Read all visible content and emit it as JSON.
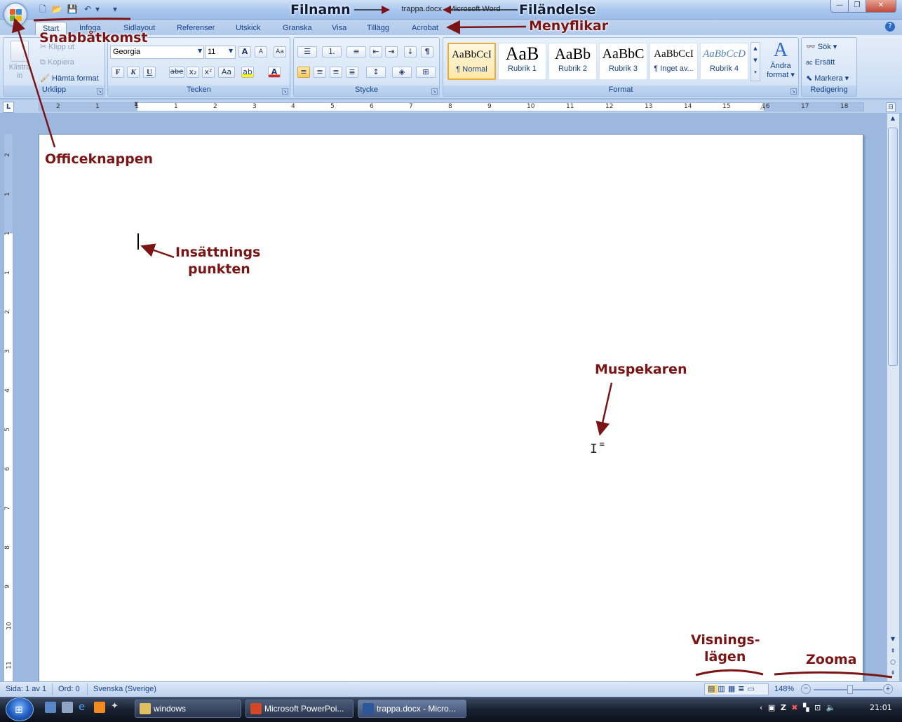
{
  "window": {
    "title_file": "trappa.docx",
    "title_sep": " - ",
    "title_app": "Microsoft Word",
    "minimize": "—",
    "maximize": "❐",
    "close": "✕"
  },
  "tabs": [
    "Start",
    "Infoga",
    "Sidlayout",
    "Referenser",
    "Utskick",
    "Granska",
    "Visa",
    "Tillägg",
    "Acrobat"
  ],
  "ribbon": {
    "clipboard": {
      "label": "Urklipp",
      "paste": "Klistra",
      "paste2": "in",
      "cut": "Klipp ut",
      "copy": "Kopiera",
      "format_painter": "Hämta format"
    },
    "font": {
      "label": "Tecken",
      "font_name": "Georgia",
      "font_size": "11",
      "bold": "F",
      "italic": "K",
      "underline": "U",
      "strike": "abe",
      "subscript": "x₂",
      "superscript": "x²",
      "case": "Aa",
      "grow": "A",
      "shrink": "A",
      "color": "A"
    },
    "paragraph": {
      "label": "Stycke"
    },
    "styles": {
      "label": "Format",
      "tiles": [
        {
          "preview": "AaBbCcI",
          "name": "¶ Normal"
        },
        {
          "preview": "AaB",
          "name": "Rubrik 1"
        },
        {
          "preview": "AaBb",
          "name": "Rubrik 2"
        },
        {
          "preview": "AaBbC",
          "name": "Rubrik 3"
        },
        {
          "preview": "AaBbCcI",
          "name": "¶ Inget av..."
        },
        {
          "preview": "AaBbCcD",
          "name": "Rubrik 4"
        }
      ],
      "change": "Ändra",
      "change2": "format"
    },
    "editing": {
      "label": "Redigering",
      "find": "Sök",
      "replace": "Ersätt",
      "select": "Markera"
    }
  },
  "ruler": {
    "h_numbers": [
      "2",
      "1",
      "1",
      "1",
      "2",
      "3",
      "4",
      "5",
      "6",
      "7",
      "8",
      "9",
      "10",
      "11",
      "12",
      "13",
      "14",
      "15",
      "16",
      "17",
      "18"
    ],
    "v_numbers": [
      "2",
      "1",
      "1",
      "1",
      "2",
      "3",
      "4",
      "5",
      "6",
      "7",
      "8",
      "9",
      "10",
      "11"
    ]
  },
  "statusbar": {
    "page": "Sida: 1 av 1",
    "words": "Ord: 0",
    "language": "Svenska (Sverige)",
    "zoom": "148%"
  },
  "taskbar": {
    "items": [
      "windows",
      "Microsoft PowerPoi...",
      "trappa.docx - Micro..."
    ],
    "clock": "21:01"
  },
  "callouts": {
    "snabb": "Snabbåtkomst",
    "filnamn": "Filnamn",
    "filandelse": "Filändelse",
    "menyflikar": "Menyflikar",
    "officeknappen": "Officeknappen",
    "insattning1": "Insättnings",
    "insattning2": "punkten",
    "muspekaren": "Muspekaren",
    "visnings1": "Visnings-",
    "visnings2": "lägen",
    "zooma": "Zooma"
  },
  "colors": {
    "callout": "#7b1414",
    "ribbon_bg": "#d0e0f4",
    "accent_selected_style": "#f0a93c"
  }
}
